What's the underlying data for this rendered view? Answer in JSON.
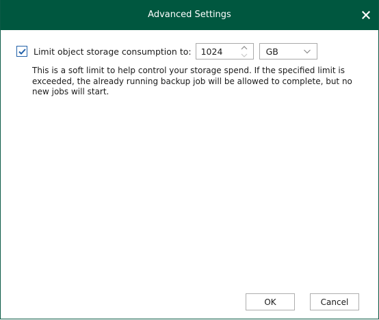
{
  "dialog": {
    "title": "Advanced Settings"
  },
  "limit": {
    "checked": true,
    "label": "Limit object storage consumption to:",
    "value": "1024",
    "unit": "GB",
    "description": "This is a soft limit to help control your storage spend. If the specified limit is exceeded, the already running backup job will be allowed to complete, but no new jobs will start."
  },
  "buttons": {
    "ok": "OK",
    "cancel": "Cancel"
  },
  "colors": {
    "titlebar": "#00573f",
    "checkbox_border": "#1f5fa8",
    "checkmark": "#1f5fa8"
  },
  "icons": {
    "close": "close-icon",
    "check": "checkmark-icon",
    "spin_up": "chevron-up-icon",
    "spin_down": "chevron-down-icon",
    "dropdown": "chevron-down-icon"
  }
}
